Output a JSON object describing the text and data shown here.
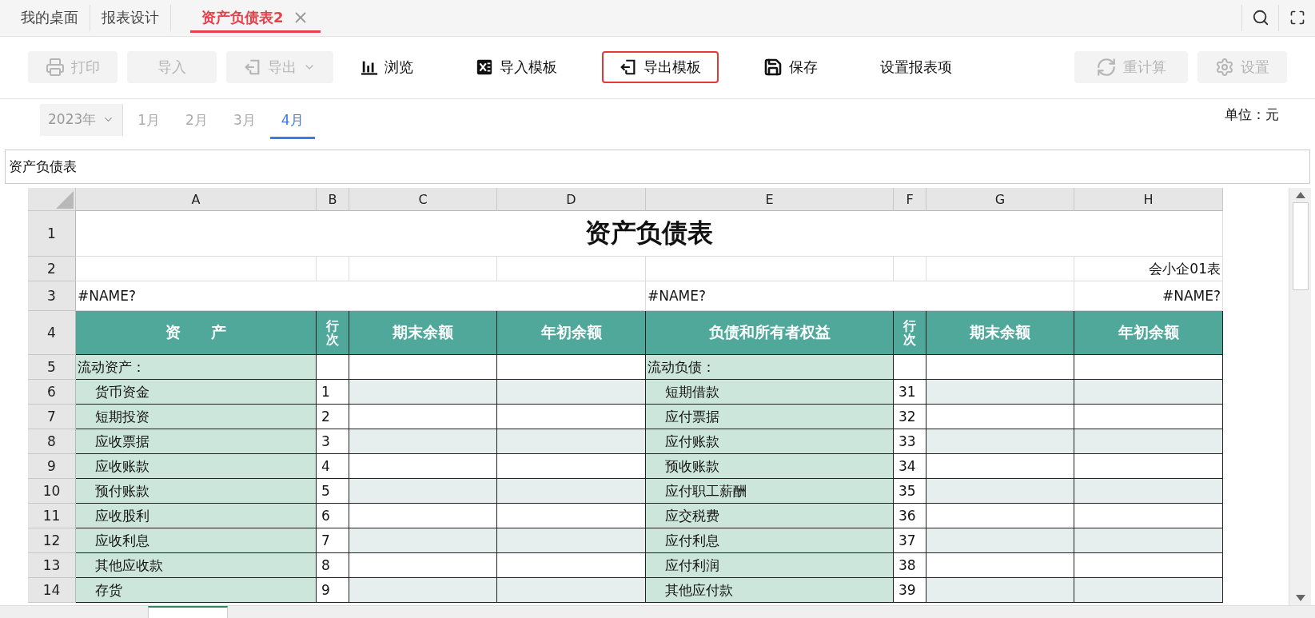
{
  "tabs": [
    {
      "label": "我的桌面",
      "selected": false,
      "closable": false
    },
    {
      "label": "报表设计",
      "selected": false,
      "closable": false
    },
    {
      "label": "资产负债表2",
      "selected": true,
      "closable": true
    }
  ],
  "toolbar_left": [
    {
      "label": "打印",
      "disabled": true,
      "highlighted": false,
      "dropdown": false
    },
    {
      "label": "导入",
      "disabled": true,
      "highlighted": false,
      "dropdown": false
    },
    {
      "label": "导出",
      "disabled": true,
      "highlighted": false,
      "dropdown": true
    },
    {
      "label": "浏览",
      "disabled": false,
      "highlighted": false,
      "dropdown": false
    },
    {
      "label": "导入模板",
      "disabled": false,
      "highlighted": false,
      "dropdown": false
    },
    {
      "label": "导出模板",
      "disabled": false,
      "highlighted": true,
      "dropdown": false
    },
    {
      "label": "保存",
      "disabled": false,
      "highlighted": false,
      "dropdown": false
    },
    {
      "label": "设置报表项",
      "disabled": false,
      "highlighted": false,
      "dropdown": false
    }
  ],
  "toolbar_right": [
    {
      "label": "重计算",
      "disabled": true
    },
    {
      "label": "设置",
      "disabled": true
    }
  ],
  "periods": {
    "year": "2023年",
    "months": [
      {
        "label": "1月",
        "selected": false
      },
      {
        "label": "2月",
        "selected": false
      },
      {
        "label": "3月",
        "selected": false
      },
      {
        "label": "4月",
        "selected": true
      }
    ]
  },
  "unit": "单位：元",
  "name_field": {
    "value": "资产负债表"
  },
  "sheet": {
    "columns": [
      "A",
      "B",
      "C",
      "D",
      "E",
      "F",
      "G",
      "H"
    ],
    "title_row": {
      "number": "1",
      "text": "资产负债表"
    },
    "form_row": {
      "number": "2",
      "text": "会小企01表"
    },
    "info_row": {
      "number": "3",
      "left": "#NAME?",
      "middle": "#NAME?",
      "right": "#NAME?"
    },
    "header_row": {
      "number": "4",
      "cells": [
        "资　　产",
        "行次",
        "期末余额",
        "年初余额",
        "负债和所有者权益",
        "行次",
        "期末余额",
        "年初余额"
      ]
    },
    "rows": [
      {
        "number": "5",
        "kind": "section",
        "shaded": false,
        "asset": "流动资产：",
        "liability": "流动负债："
      },
      {
        "number": "6",
        "kind": "item",
        "shaded": true,
        "asset": "货币资金",
        "asset_line": "1",
        "liability": "短期借款",
        "liability_line": "31"
      },
      {
        "number": "7",
        "kind": "item",
        "shaded": false,
        "asset": "短期投资",
        "asset_line": "2",
        "liability": "应付票据",
        "liability_line": "32"
      },
      {
        "number": "8",
        "kind": "item",
        "shaded": true,
        "asset": "应收票据",
        "asset_line": "3",
        "liability": "应付账款",
        "liability_line": "33"
      },
      {
        "number": "9",
        "kind": "item",
        "shaded": false,
        "asset": "应收账款",
        "asset_line": "4",
        "liability": "预收账款",
        "liability_line": "34"
      },
      {
        "number": "10",
        "kind": "item",
        "shaded": true,
        "asset": "预付账款",
        "asset_line": "5",
        "liability": "应付职工薪酬",
        "liability_line": "35"
      },
      {
        "number": "11",
        "kind": "item",
        "shaded": false,
        "asset": "应收股利",
        "asset_line": "6",
        "liability": "应交税费",
        "liability_line": "36"
      },
      {
        "number": "12",
        "kind": "item",
        "shaded": true,
        "asset": "应收利息",
        "asset_line": "7",
        "liability": "应付利息",
        "liability_line": "37"
      },
      {
        "number": "13",
        "kind": "item",
        "shaded": false,
        "asset": "其他应收款",
        "asset_line": "8",
        "liability": "应付利润",
        "liability_line": "38"
      },
      {
        "number": "14",
        "kind": "item",
        "shaded": true,
        "asset": "存货",
        "asset_line": "9",
        "liability": "其他应付款",
        "liability_line": "39"
      }
    ]
  }
}
